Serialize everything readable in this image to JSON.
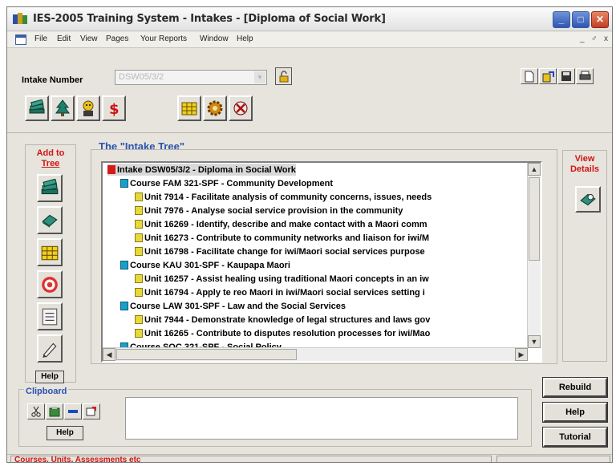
{
  "window": {
    "title": "IES-2005 Training System - Intakes - [Diploma of Social Work]",
    "controls": {
      "minimize": "_",
      "maximize": "□",
      "close": "✕"
    }
  },
  "menubar": {
    "items": [
      "File",
      "Edit",
      "View",
      "Pages",
      "Your Reports",
      "Window",
      "Help"
    ],
    "mdi_controls": [
      "_",
      "♂",
      "x"
    ]
  },
  "intake": {
    "label": "Intake Number",
    "value": "DSW05/3/2"
  },
  "tree": {
    "title": "The \"Intake Tree\"",
    "rows": [
      {
        "type": "root",
        "text": "Intake DSW05/3/2 - Diploma in Social Work",
        "selected": true
      },
      {
        "type": "course",
        "text": "Course FAM 321-SPF - Community Development"
      },
      {
        "type": "unit",
        "text": "Unit 7914 - Facilitate analysis of community concerns, issues, needs"
      },
      {
        "type": "unit",
        "text": "Unit 7976 - Analyse social service provision in the community"
      },
      {
        "type": "unit",
        "text": "Unit 16269 - Identify, describe and make contact with a Maori comm"
      },
      {
        "type": "unit",
        "text": "Unit 16273 - Contribute to community networks and liaison for iwi/M"
      },
      {
        "type": "unit",
        "text": "Unit 16798 - Facilitate change for iwi/Maori social services purpose"
      },
      {
        "type": "course",
        "text": "Course KAU 301-SPF - Kaupapa Maori"
      },
      {
        "type": "unit",
        "text": "Unit 16257 - Assist healing using traditional Maori concepts in an iw"
      },
      {
        "type": "unit",
        "text": "Unit 16794 - Apply te reo Maori in iwi/Maori social services setting i"
      },
      {
        "type": "course",
        "text": "Course LAW 301-SPF - Law and the Social Services"
      },
      {
        "type": "unit",
        "text": "Unit 7944 - Demonstrate knowledge of legal structures and laws gov"
      },
      {
        "type": "unit",
        "text": "Unit 16265 - Contribute to disputes resolution processes for iwi/Mao"
      },
      {
        "type": "course",
        "text": "Course SOC 321-SPF - Social Policy"
      }
    ]
  },
  "add_to_tree": {
    "label_line1": "Add to",
    "label_line2": "Tree",
    "help": "Help"
  },
  "view_details": {
    "label_line1": "View",
    "label_line2": "Details"
  },
  "clipboard": {
    "label": "Clipboard",
    "help": "Help"
  },
  "actions": {
    "rebuild": "Rebuild",
    "help": "Help",
    "tutorial": "Tutorial"
  },
  "status": {
    "text": "Courses, Units, Assessments etc"
  }
}
